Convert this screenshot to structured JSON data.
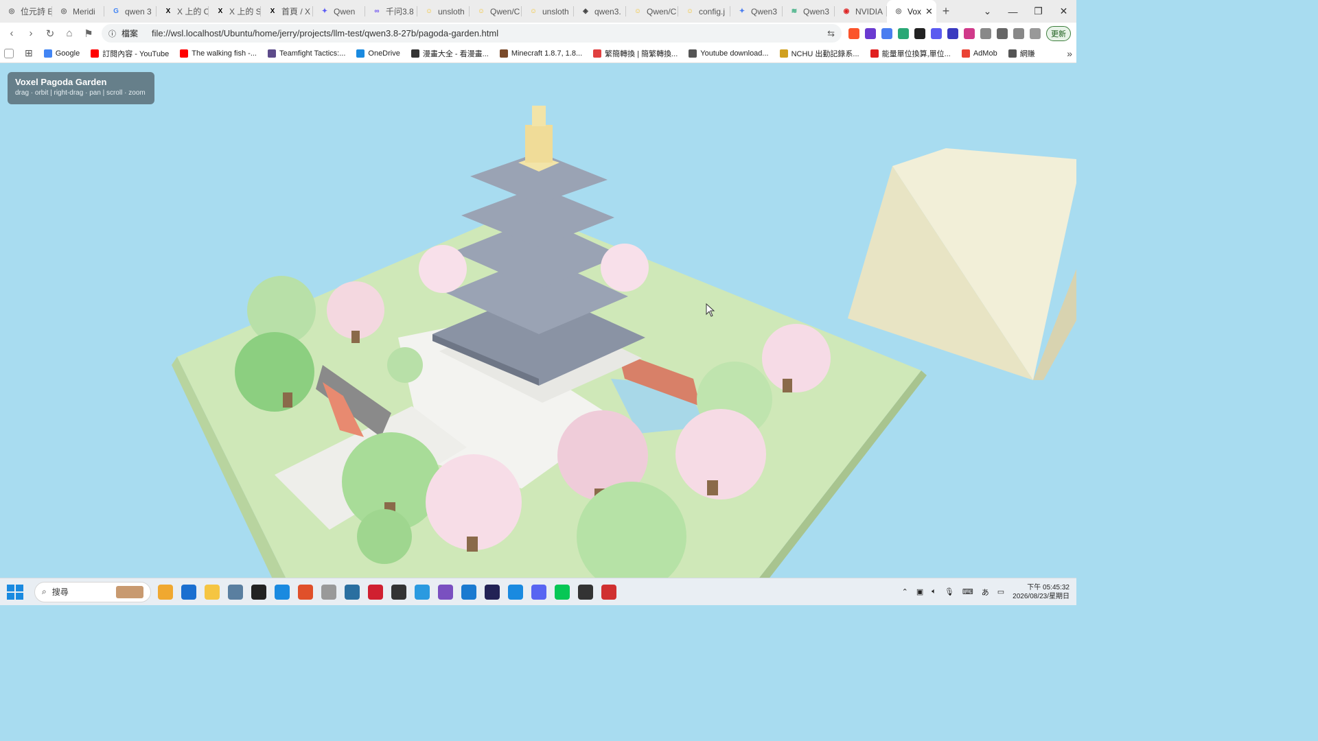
{
  "browser": {
    "tabs": [
      {
        "label": "位元詩 E",
        "color": "#666666",
        "glyph": "◎"
      },
      {
        "label": "Meridi",
        "color": "#666666",
        "glyph": "◎"
      },
      {
        "label": "qwen 3",
        "color": "#4285f4",
        "glyph": "G"
      },
      {
        "label": "X 上的 C",
        "color": "#000000",
        "glyph": "X"
      },
      {
        "label": "X 上的 S",
        "color": "#000000",
        "glyph": "X"
      },
      {
        "label": "首頁 / X",
        "color": "#000000",
        "glyph": "X"
      },
      {
        "label": "Qwen",
        "color": "#5b5bf5",
        "glyph": "✦"
      },
      {
        "label": "千问3.8",
        "color": "#6a4cf0",
        "glyph": "∞"
      },
      {
        "label": "unsloth",
        "color": "#f4c430",
        "glyph": "☺"
      },
      {
        "label": "Qwen/C",
        "color": "#f4c430",
        "glyph": "☺"
      },
      {
        "label": "unsloth",
        "color": "#f4c430",
        "glyph": "☺"
      },
      {
        "label": "qwen3.",
        "color": "#444444",
        "glyph": "◈"
      },
      {
        "label": "Qwen/C",
        "color": "#f4c430",
        "glyph": "☺"
      },
      {
        "label": "config.j",
        "color": "#f4c430",
        "glyph": "☺"
      },
      {
        "label": "Qwen3",
        "color": "#4a7df0",
        "glyph": "✦"
      },
      {
        "label": "Qwen3",
        "color": "#2aa876",
        "glyph": "≋"
      },
      {
        "label": "NVIDIA",
        "color": "#d22",
        "glyph": "◉"
      },
      {
        "label": "Vox",
        "color": "#666666",
        "glyph": "◎",
        "active": true
      }
    ],
    "new_tab": "+",
    "url_label": "檔案",
    "url": "file://wsl.localhost/Ubuntu/home/jerry/projects/llm-test/qwen3.8-27b/pagoda-garden.html",
    "update_label": "更新",
    "bookmarks": [
      {
        "label": "Google",
        "color": "#4285f4"
      },
      {
        "label": "訂閱內容 - YouTube",
        "color": "#ff0000"
      },
      {
        "label": "The walking fish -...",
        "color": "#ff0000"
      },
      {
        "label": "Teamfight Tactics:...",
        "color": "#5d4b8a"
      },
      {
        "label": "OneDrive",
        "color": "#1a8ae0"
      },
      {
        "label": "漫畫大全 - 看漫畫...",
        "color": "#333333"
      },
      {
        "label": "Minecraft 1.8.7, 1.8...",
        "color": "#7a4a2a"
      },
      {
        "label": "繁簡轉換 | 簡繁轉換...",
        "color": "#e04040"
      },
      {
        "label": "Youtube download...",
        "color": "#555555"
      },
      {
        "label": "NCHU 出勤記錄系...",
        "color": "#d0a020"
      },
      {
        "label": "能量單位換算,單位...",
        "color": "#e02020"
      },
      {
        "label": "AdMob",
        "color": "#ea4335"
      },
      {
        "label": "網賺",
        "color": "#555555"
      }
    ],
    "more_bookmarks": "»"
  },
  "scene": {
    "title": "Voxel Pagoda Garden",
    "hint": "drag · orbit  |  right-drag · pan  |  scroll · zoom"
  },
  "taskbar": {
    "search_placeholder": "搜尋",
    "time": "下午 05:45:32",
    "date": "2026/08/23/星期日",
    "apps": [
      "#f0a830",
      "#1a6fd0",
      "#f5c542",
      "#5a7fa0",
      "#222222",
      "#1a8ae0",
      "#e0502a",
      "#999999",
      "#2a6fa0",
      "#d02030",
      "#333333",
      "#2a9ae0",
      "#7a50c0",
      "#1a7ad0",
      "#222255",
      "#1a8ae0",
      "#5865f2",
      "#06c755",
      "#333333",
      "#d03030"
    ]
  }
}
